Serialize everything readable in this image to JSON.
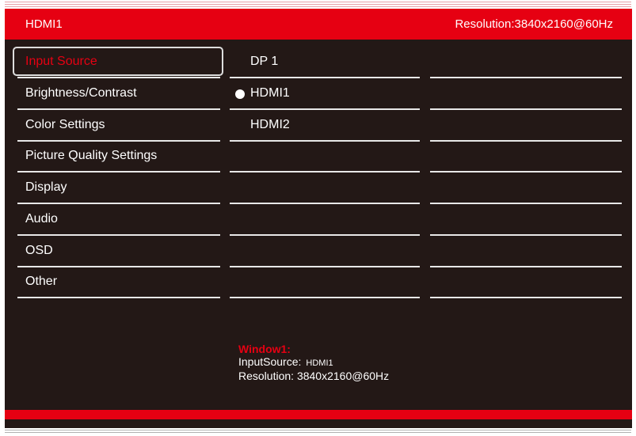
{
  "header": {
    "source": "HDMI1",
    "resolution": "Resolution:3840x2160@60Hz"
  },
  "menu": [
    {
      "label": "Input Source",
      "selected": true
    },
    {
      "label": "Brightness/Contrast"
    },
    {
      "label": "Color Settings"
    },
    {
      "label": "Picture Quality Settings"
    },
    {
      "label": "Display"
    },
    {
      "label": "Audio"
    },
    {
      "label": "OSD"
    },
    {
      "label": "Other"
    }
  ],
  "submenu": [
    {
      "label": "DP 1",
      "active": false
    },
    {
      "label": "HDMI1",
      "active": true
    },
    {
      "label": "HDMI2",
      "active": false
    }
  ],
  "info": {
    "title": "Window1:",
    "input_label": "InputSource:",
    "input_value": "HDMI1",
    "res_label": "Resolution:",
    "res_value": "3840x2160@60Hz"
  },
  "colors": {
    "accent": "#e60012",
    "background": "#231816"
  }
}
